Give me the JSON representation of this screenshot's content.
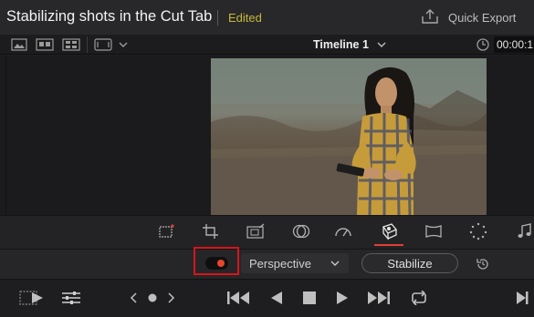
{
  "header": {
    "title": "Stabilizing shots in the Cut Tab",
    "status": "Edited",
    "quick_export_label": "Quick Export"
  },
  "viewer_toolbar": {
    "timeline_name": "Timeline 1",
    "timecode": "00:00:1"
  },
  "inspector_tools": {
    "items": [
      "transform",
      "crop",
      "dynamic-zoom",
      "composite",
      "speed",
      "stabilization",
      "lens-correction",
      "smooth-cut",
      "audio"
    ],
    "active": "stabilization"
  },
  "stabilization": {
    "enabled": true,
    "mode": "Perspective",
    "stabilize_label": "Stabilize"
  },
  "colors": {
    "accent_red": "#e04035",
    "highlight_box": "#d9141a",
    "status_yellow": "#c9b93a"
  }
}
